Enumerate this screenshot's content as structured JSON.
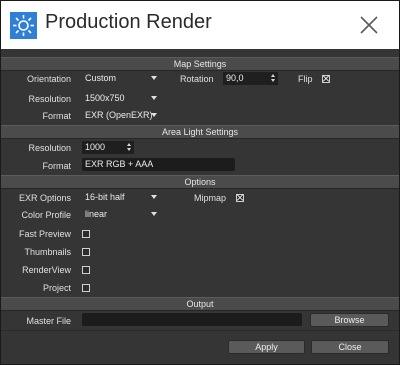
{
  "window": {
    "title": "Production Render"
  },
  "sections": {
    "map_settings": "Map Settings",
    "area_light": "Area Light Settings",
    "options": "Options",
    "output": "Output"
  },
  "map": {
    "orientation_label": "Orientation",
    "orientation_value": "Custom",
    "rotation_label": "Rotation",
    "rotation_value": "90,0",
    "flip_label": "Flip",
    "flip_checked": true,
    "resolution_label": "Resolution",
    "resolution_value": "1500x750",
    "format_label": "Format",
    "format_value": "EXR (OpenEXR)"
  },
  "area_light": {
    "resolution_label": "Resolution",
    "resolution_value": "1000",
    "format_label": "Format",
    "format_value": "EXR RGB + AAA"
  },
  "options": {
    "exr_label": "EXR Options",
    "exr_value": "16-bit half",
    "mipmap_label": "Mipmap",
    "mipmap_checked": true,
    "color_profile_label": "Color Profile",
    "color_profile_value": "linear",
    "fast_preview_label": "Fast Preview",
    "thumbnails_label": "Thumbnails",
    "renderview_label": "RenderView",
    "project_label": "Project"
  },
  "output": {
    "master_file_label": "Master File",
    "master_file_value": "",
    "browse_label": "Browse"
  },
  "footer": {
    "apply_label": "Apply",
    "close_label": "Close"
  },
  "colors": {
    "accent": "#2f7fd6",
    "panel": "#353535",
    "section": "#4b4b4b",
    "field": "#1c1c1c"
  }
}
